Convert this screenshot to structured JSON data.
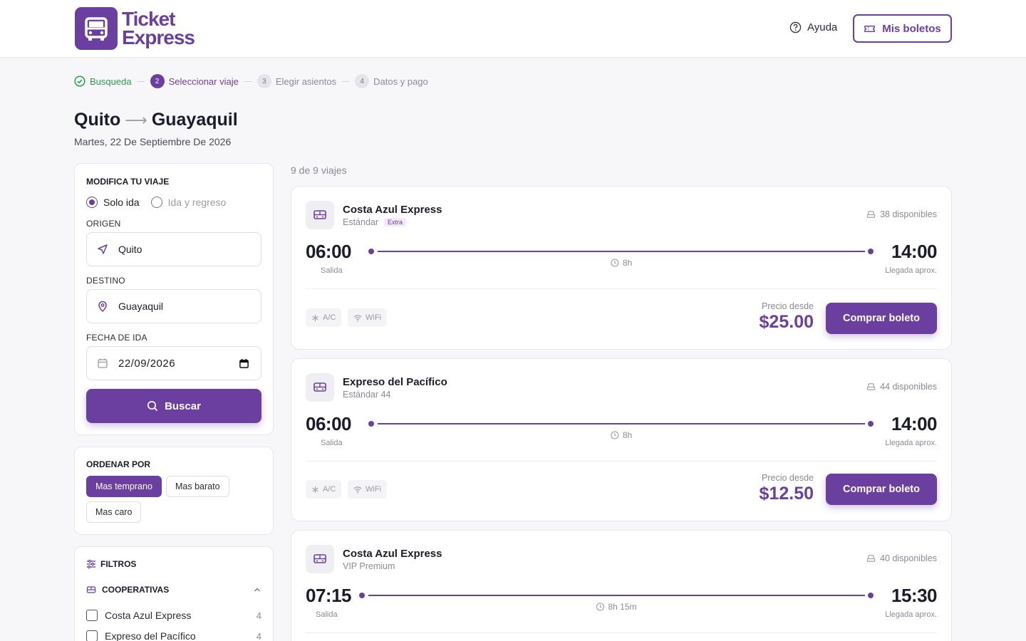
{
  "brand": {
    "line1": "Ticket",
    "line2": "Express",
    "color": "#6b3fa0"
  },
  "header": {
    "help_label": "Ayuda",
    "my_tickets_label": "Mis boletos"
  },
  "steps": [
    {
      "label": "Busqueda",
      "state": "done"
    },
    {
      "num": "2",
      "label": "Seleccionar viaje",
      "state": "active"
    },
    {
      "num": "3",
      "label": "Elegir asientos",
      "state": "todo"
    },
    {
      "num": "4",
      "label": "Datos y pago",
      "state": "todo"
    }
  ],
  "route": {
    "from": "Quito",
    "arrow": "⟶",
    "to": "Guayaquil",
    "date": "Martes, 22 De Septiembre De 2026"
  },
  "modify": {
    "title": "MODIFICA TU VIAJE",
    "one_way": "Solo ida",
    "round_trip": "Ida y regreso",
    "origin_label": "ORIGEN",
    "origin_value": "Quito",
    "dest_label": "DESTINO",
    "dest_value": "Guayaquil",
    "date_label": "FECHA DE IDA",
    "date_value": "22/09/2026",
    "search_label": "Buscar"
  },
  "sort": {
    "title": "ORDENAR POR",
    "options": [
      "Mas temprano",
      "Mas barato",
      "Mas caro"
    ],
    "selected": "Mas temprano"
  },
  "filters": {
    "title": "FILTROS",
    "coop_title": "COOPERATIVAS",
    "items": [
      {
        "label": "Costa Azul Express",
        "count": "4"
      },
      {
        "label": "Expreso del Pacífico",
        "count": "4"
      }
    ]
  },
  "results": {
    "count_text": "9 de 9 viajes",
    "trips": [
      {
        "operator": "Costa Azul Express",
        "class": "Estándar",
        "badge": "Extra",
        "seats": "38 disponibles",
        "depart": "06:00",
        "depart_label": "Salida",
        "arrive": "14:00",
        "arrive_label": "Llegada aprox.",
        "duration": "8h",
        "amenities": [
          "A/C",
          "WiFi"
        ],
        "price_label": "Precio desde",
        "price": "$25.00",
        "buy_label": "Comprar boleto"
      },
      {
        "operator": "Expreso del Pacífico",
        "class": "Estándar 44",
        "badge": "",
        "seats": "44 disponibles",
        "depart": "06:00",
        "depart_label": "Salida",
        "arrive": "14:00",
        "arrive_label": "Llegada aprox.",
        "duration": "8h",
        "amenities": [
          "A/C",
          "WiFi"
        ],
        "price_label": "Precio desde",
        "price": "$12.50",
        "buy_label": "Comprar boleto"
      },
      {
        "operator": "Costa Azul Express",
        "class": "VIP Premium",
        "badge": "",
        "seats": "40 disponibles",
        "depart": "07:15",
        "depart_label": "Salida",
        "arrive": "15:30",
        "arrive_label": "Llegada aprox.",
        "duration": "8h 15m"
      }
    ]
  }
}
